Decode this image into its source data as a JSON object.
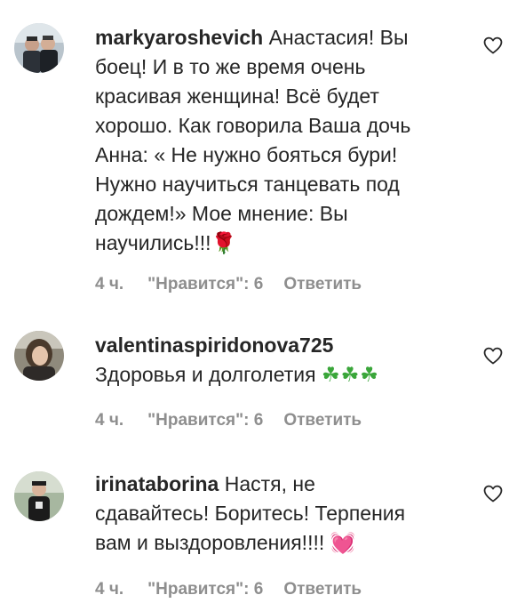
{
  "comments": [
    {
      "username": "markyaroshevich",
      "text": "Анастасия! Вы\nбоец! И в то же время очень\nкрасивая женщина! Всё будет\nхорошо. Как говорила Ваша дочь\nАнна: « Не нужно бояться бури!\nНужно научиться танцевать под\nдождем!» Мое мнение: Вы\nнаучились!!!",
      "emoji": "🌹",
      "emoji_name": "rose-emoji",
      "time": "4 ч.",
      "likes": "\"Нравится\": 6",
      "reply": "Ответить"
    },
    {
      "username": "valentinaspiridonova725",
      "text": "Здоровья и долголетия ",
      "emoji": "☘☘☘",
      "emoji_name": "shamrock-emoji",
      "time": "4 ч.",
      "likes": "\"Нравится\": 6",
      "reply": "Ответить"
    },
    {
      "username": "irinataborina",
      "text": "Настя, не\nсдавайтесь! Боритесь! Терпения\nвам и выздоровления!!!! ",
      "emoji": "💓",
      "emoji_name": "growing-heart-emoji",
      "time": "4 ч.",
      "likes": "\"Нравится\": 6",
      "reply": "Ответить"
    }
  ],
  "colors": {
    "text": "#262626",
    "meta": "#8e8e8e",
    "background": "#ffffff"
  },
  "icons": {
    "like": "heart-outline-icon"
  }
}
